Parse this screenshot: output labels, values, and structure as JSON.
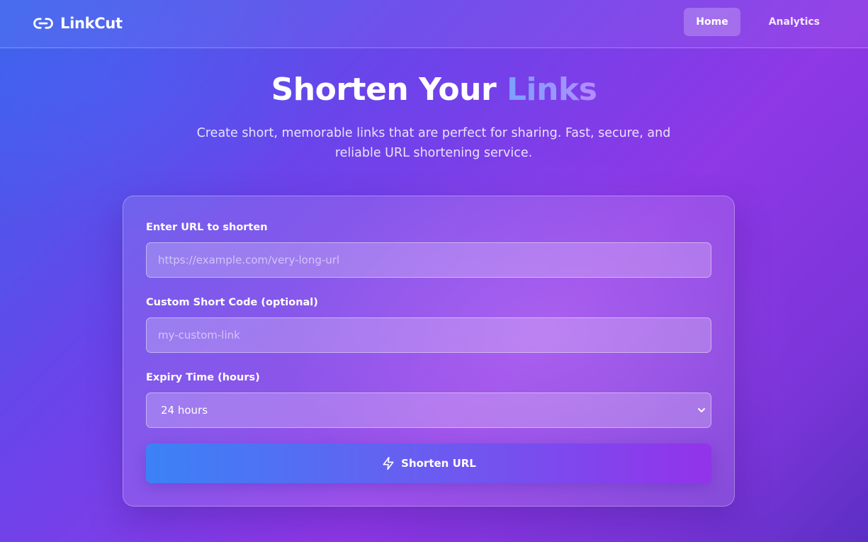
{
  "header": {
    "brand": "LinkCut",
    "brand_icon": "link-icon",
    "nav": [
      {
        "label": "Home",
        "active": true
      },
      {
        "label": "Analytics",
        "active": false
      }
    ]
  },
  "hero": {
    "title_main": "Shorten Your",
    "title_accent": "Links",
    "subtitle": "Create short, memorable links that are perfect for sharing. Fast, secure, and reliable URL shortening service."
  },
  "form": {
    "url_label": "Enter URL to shorten",
    "url_placeholder": "https://example.com/very-long-url",
    "url_value": "",
    "code_label": "Custom Short Code (optional)",
    "code_placeholder": "my-custom-link",
    "code_value": "",
    "expiry_label": "Expiry Time (hours)",
    "expiry_selected": "24 hours",
    "expiry_icon": "chevron-down-icon",
    "submit_label": "Shorten URL",
    "submit_icon": "lightning-icon"
  },
  "colors": {
    "background_start": "#3a63ea",
    "background_end": "#8e38e6",
    "button_start": "#3b82f6",
    "button_end": "#9333ea",
    "accent_text_start": "#7aa2ff",
    "accent_text_end": "#b58cff"
  }
}
